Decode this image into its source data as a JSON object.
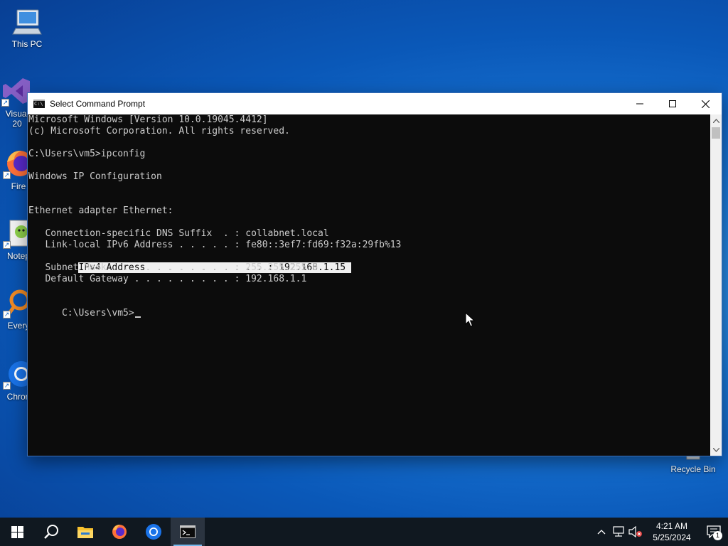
{
  "desktop": {
    "icons": [
      {
        "label": "This PC",
        "icon": "computer-icon"
      },
      {
        "label": "Visual\n20",
        "icon": "visual-studio-icon"
      },
      {
        "label": "Fire",
        "icon": "firefox-icon"
      },
      {
        "label": "Notep",
        "icon": "notepad-plus-plus-icon"
      },
      {
        "label": "Every",
        "icon": "everything-search-icon"
      },
      {
        "label": "Chron",
        "icon": "chrome-icon"
      },
      {
        "label": "Recycle Bin",
        "icon": "recycle-bin-icon"
      }
    ]
  },
  "window": {
    "title": "Select Command Prompt",
    "controls": {
      "minimize": "minimize-icon",
      "maximize": "maximize-icon",
      "close": "close-icon"
    },
    "console": {
      "lines": [
        "Microsoft Windows [Version 10.0.19045.4412]",
        "(c) Microsoft Corporation. All rights reserved.",
        "",
        "C:\\Users\\vm5>ipconfig",
        "",
        "Windows IP Configuration",
        "",
        "",
        "Ethernet adapter Ethernet:",
        "",
        "   Connection-specific DNS Suffix  . : collabnet.local",
        "   Link-local IPv6 Address . . . . . : fe80::3ef7:fd69:f32a:29fb%13",
        "   IPv4 Address. . . . . . . . . . . : 192.168.1.15",
        "   Subnet Mask . . . . . . . . . . . : 255.255.255.0",
        "   Default Gateway . . . . . . . . . : 192.168.1.1",
        "",
        "C:\\Users\\vm5>"
      ],
      "selection_prefix": "   ",
      "selected_text": "IPv4 Address. . . . . . . . . . . : 192.168.1.15 ",
      "prompt": "C:\\Users\\vm5>"
    }
  },
  "taskbar": {
    "buttons": [
      {
        "name": "start-button",
        "icon": "windows-logo-icon"
      },
      {
        "name": "search-button",
        "icon": "search-icon"
      },
      {
        "name": "file-explorer-button",
        "icon": "folder-icon"
      },
      {
        "name": "firefox-button",
        "icon": "firefox-icon"
      },
      {
        "name": "chrome-button",
        "icon": "chrome-icon"
      },
      {
        "name": "command-prompt-button",
        "icon": "command-prompt-icon",
        "active": true
      }
    ],
    "tray": {
      "time": "4:21 AM",
      "date": "5/25/2024",
      "notification_count": "1"
    }
  },
  "colors": {
    "console_bg": "#0c0c0c",
    "console_fg": "#cccccc",
    "selection_bg": "#f0f0f0",
    "taskbar_bg": "#101820",
    "desktop_accent": "#0a58b8"
  }
}
